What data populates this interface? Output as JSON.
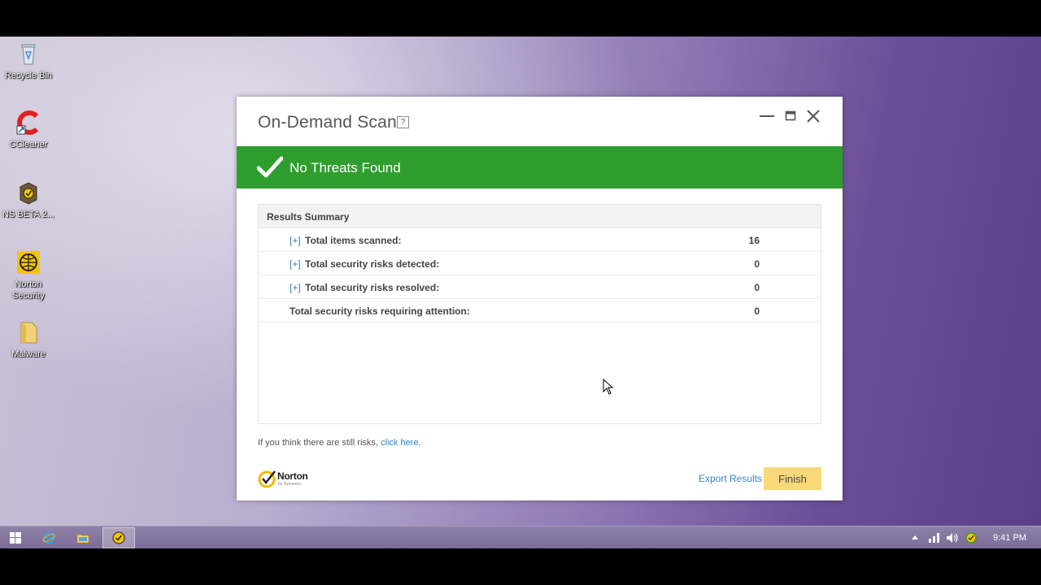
{
  "desktop": {
    "icons": [
      {
        "label": "Recycle Bin"
      },
      {
        "label": "CCleaner"
      },
      {
        "label": "NS BETA 2..."
      },
      {
        "label": "Norton Security"
      },
      {
        "label": "Malware"
      }
    ]
  },
  "dialog": {
    "title": "On-Demand Scan",
    "help_label": "?",
    "banner_text": "No Threats Found",
    "results": {
      "header": "Results Summary",
      "rows": [
        {
          "expander": "[+]",
          "label": "Total items scanned:",
          "value": "16"
        },
        {
          "expander": "[+]",
          "label": "Total security risks detected:",
          "value": "0"
        },
        {
          "expander": "[+]",
          "label": "Total security risks resolved:",
          "value": "0"
        },
        {
          "expander": "",
          "label": "Total security risks requiring attention:",
          "value": "0"
        }
      ]
    },
    "hint_prefix": "If you think there are still risks, ",
    "hint_link": "click here",
    "hint_suffix": ".",
    "brand_name": "Norton",
    "brand_sub": "by Symantec",
    "export_label": "Export Results",
    "finish_label": "Finish"
  },
  "taskbar": {
    "clock": "9:41 PM"
  },
  "colors": {
    "banner_green": "#2e9e2e",
    "finish_yellow": "#f8d979",
    "link_blue": "#3a85c8"
  }
}
